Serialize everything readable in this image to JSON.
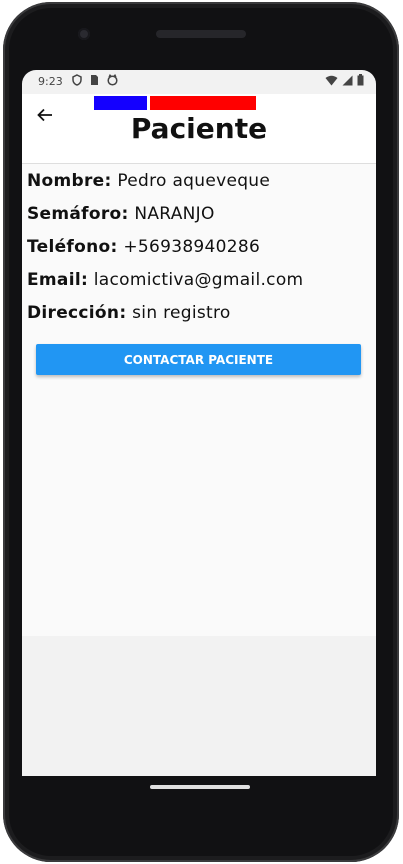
{
  "status_bar": {
    "time": "9:23",
    "left_icons": [
      "shield-icon",
      "sim-card-icon",
      "cat-face-icon"
    ],
    "right_icons": [
      "wifi-icon",
      "signal-icon",
      "battery-icon"
    ]
  },
  "appbar": {
    "title": "Paciente",
    "back_icon": "arrow-back-icon",
    "flag_colors": [
      "#1400ff",
      "#ff0000"
    ]
  },
  "patient": {
    "name_label": "Nombre:",
    "name_value": "Pedro aqueveque",
    "semaforo_label": "Semáforo:",
    "semaforo_value": "NARANJO",
    "telefono_label": "Teléfono:",
    "telefono_value": "+56938940286",
    "email_label": "Email:",
    "email_value": "lacomictiva@gmail.com",
    "direccion_label": "Dirección:",
    "direccion_value": "sin registro"
  },
  "actions": {
    "contact_button": "CONTACTAR PACIENTE"
  },
  "colors": {
    "accent": "#2196f3",
    "flag_blue": "#1400ff",
    "flag_red": "#ff0000"
  }
}
